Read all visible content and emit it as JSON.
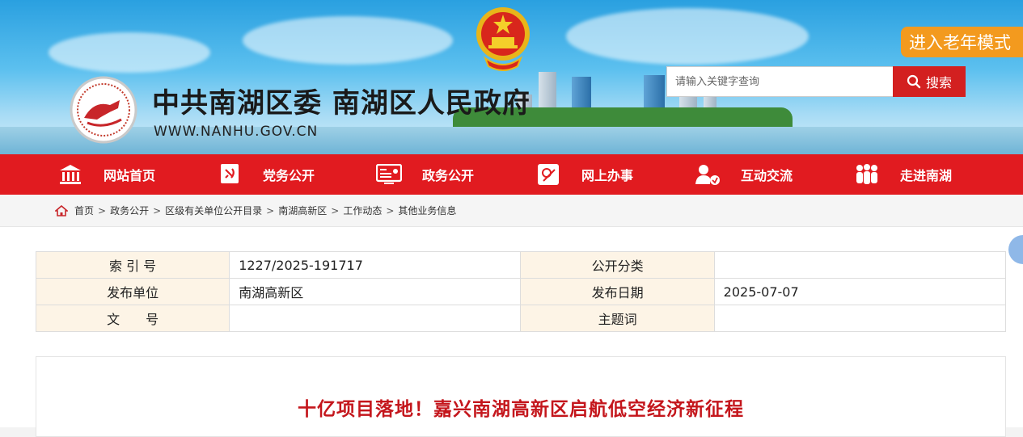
{
  "header": {
    "site_title": "中共南湖区委 南湖区人民政府",
    "site_url": "WWW.NANHU.GOV.CN",
    "elder_mode_label": "进入老年模式",
    "search": {
      "placeholder": "请输入关键字查询",
      "button_label": "搜索"
    }
  },
  "nav": {
    "items": [
      {
        "label": "网站首页",
        "icon": "building-icon"
      },
      {
        "label": "党务公开",
        "icon": "party-flag-icon"
      },
      {
        "label": "政务公开",
        "icon": "document-screen-icon"
      },
      {
        "label": "网上办事",
        "icon": "online-service-icon"
      },
      {
        "label": "互动交流",
        "icon": "interaction-icon"
      },
      {
        "label": "走进南湖",
        "icon": "people-icon"
      }
    ]
  },
  "breadcrumb": [
    "首页",
    "政务公开",
    "区级有关单位公开目录",
    "南湖高新区",
    "工作动态",
    "其他业务信息"
  ],
  "meta_table": {
    "rows": [
      [
        {
          "label": "索 引 号",
          "value": "1227/2025-191717"
        },
        {
          "label": "公开分类",
          "value": ""
        }
      ],
      [
        {
          "label": "发布单位",
          "value": "南湖高新区"
        },
        {
          "label": "发布日期",
          "value": "2025-07-07"
        }
      ],
      [
        {
          "label": "文　　号",
          "value": ""
        },
        {
          "label": "主题词",
          "value": ""
        }
      ]
    ]
  },
  "article": {
    "title": "十亿项目落地！嘉兴南湖高新区启航低空经济新征程"
  },
  "colors": {
    "nav_red": "#e11b20",
    "title_red": "#c4161c",
    "elder_orange": "#f39a1e",
    "label_bg": "#fdf4e6"
  }
}
